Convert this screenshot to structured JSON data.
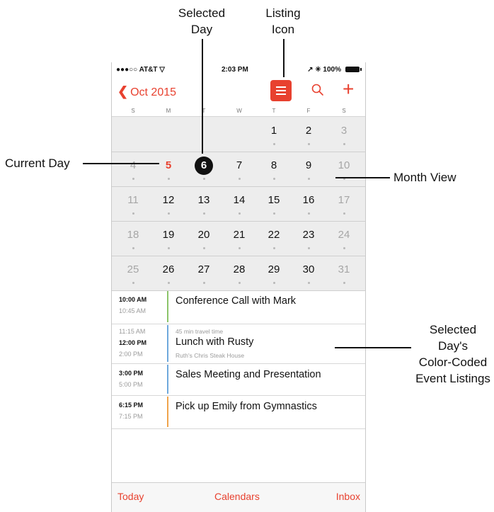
{
  "annotations": {
    "selected_day_line1": "Selected",
    "selected_day_line2": "Day",
    "listing_icon_line1": "Listing",
    "listing_icon_line2": "Icon",
    "current_day": "Current Day",
    "month_view": "Month View",
    "event_listings_line1": "Selected Day's",
    "event_listings_line2": "Color-Coded",
    "event_listings_line3": "Event Listings"
  },
  "status_bar": {
    "carrier": "●●●○○ AT&T ▽",
    "time": "2:03 PM",
    "battery": "↗ ✳ 100%"
  },
  "nav": {
    "back_chevron": "❮",
    "back_label": "Oct 2015",
    "plus": "+"
  },
  "weekdays": [
    "S",
    "M",
    "T",
    "W",
    "T",
    "F",
    "S"
  ],
  "month": {
    "weeks": [
      [
        null,
        null,
        null,
        null,
        "1",
        "2",
        "3"
      ],
      [
        "4",
        "5",
        "6",
        "7",
        "8",
        "9",
        "10"
      ],
      [
        "11",
        "12",
        "13",
        "14",
        "15",
        "16",
        "17"
      ],
      [
        "18",
        "19",
        "20",
        "21",
        "22",
        "23",
        "24"
      ],
      [
        "25",
        "26",
        "27",
        "28",
        "29",
        "30",
        "31"
      ]
    ],
    "today": "5",
    "selected": "6"
  },
  "events": [
    {
      "start": "10:00 AM",
      "end": "10:45 AM",
      "title": "Conference Call with Mark",
      "color": "#8cc46a"
    },
    {
      "travel_start": "11:15 AM",
      "start": "12:00 PM",
      "end": "2:00 PM",
      "travel": "45 min travel time",
      "title": "Lunch with Rusty",
      "location": "Ruth's Chris Steak House",
      "color": "#6fa8dc"
    },
    {
      "start": "3:00 PM",
      "end": "5:00 PM",
      "title": "Sales Meeting and Presentation",
      "color": "#6fa8dc"
    },
    {
      "start": "6:15 PM",
      "end": "7:15 PM",
      "title": "Pick up Emily from Gymnastics",
      "color": "#f0a44c"
    }
  ],
  "tabs": {
    "today": "Today",
    "calendars": "Calendars",
    "inbox": "Inbox"
  },
  "colors": {
    "accent": "#e8412f",
    "selected_circle": "#111111"
  }
}
